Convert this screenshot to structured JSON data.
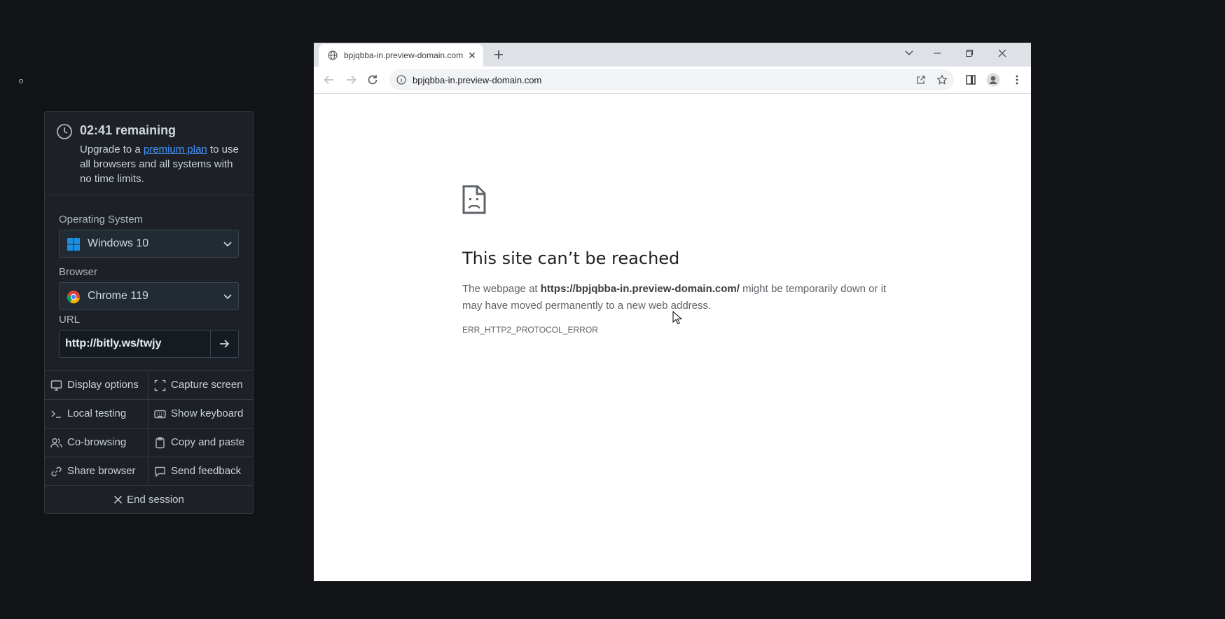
{
  "panel": {
    "timer_title": "02:41 remaining",
    "timer_text_before": "Upgrade to a ",
    "timer_link": "premium plan",
    "timer_text_after": " to use all browsers and all systems with no time limits.",
    "os_label": "Operating System",
    "os_value": "Windows 10",
    "browser_label": "Browser",
    "browser_value": "Chrome 119",
    "url_label": "URL",
    "url_value": "http://bitly.ws/twjy",
    "actions": {
      "display_options": "Display options",
      "capture_screen": "Capture screen",
      "local_testing": "Local testing",
      "show_keyboard": "Show keyboard",
      "co_browsing": "Co-browsing",
      "copy_and_paste": "Copy and paste",
      "share_browser": "Share browser",
      "send_feedback": "Send feedback",
      "end_session": "End session"
    },
    "colors": {
      "link": "#4493f8",
      "panel_bg": "#1d2127"
    }
  },
  "browser": {
    "tab_title": "bpjqbba-in.preview-domain.com",
    "address": "bpjqbba-in.preview-domain.com",
    "error": {
      "title": "This site can’t be reached",
      "desc_before": "The webpage at ",
      "desc_url": "https://bpjqbba-in.preview-domain.com/",
      "desc_after": " might be temporarily down or it may have moved permanently to a new web address.",
      "code": "ERR_HTTP2_PROTOCOL_ERROR"
    },
    "icons": [
      "globe-icon",
      "close-icon",
      "plus-icon",
      "back-icon",
      "forward-icon",
      "reload-icon",
      "info-icon",
      "share-icon",
      "star-icon",
      "side-panel-icon",
      "profile-icon",
      "menu-icon",
      "sad-page-icon"
    ]
  }
}
